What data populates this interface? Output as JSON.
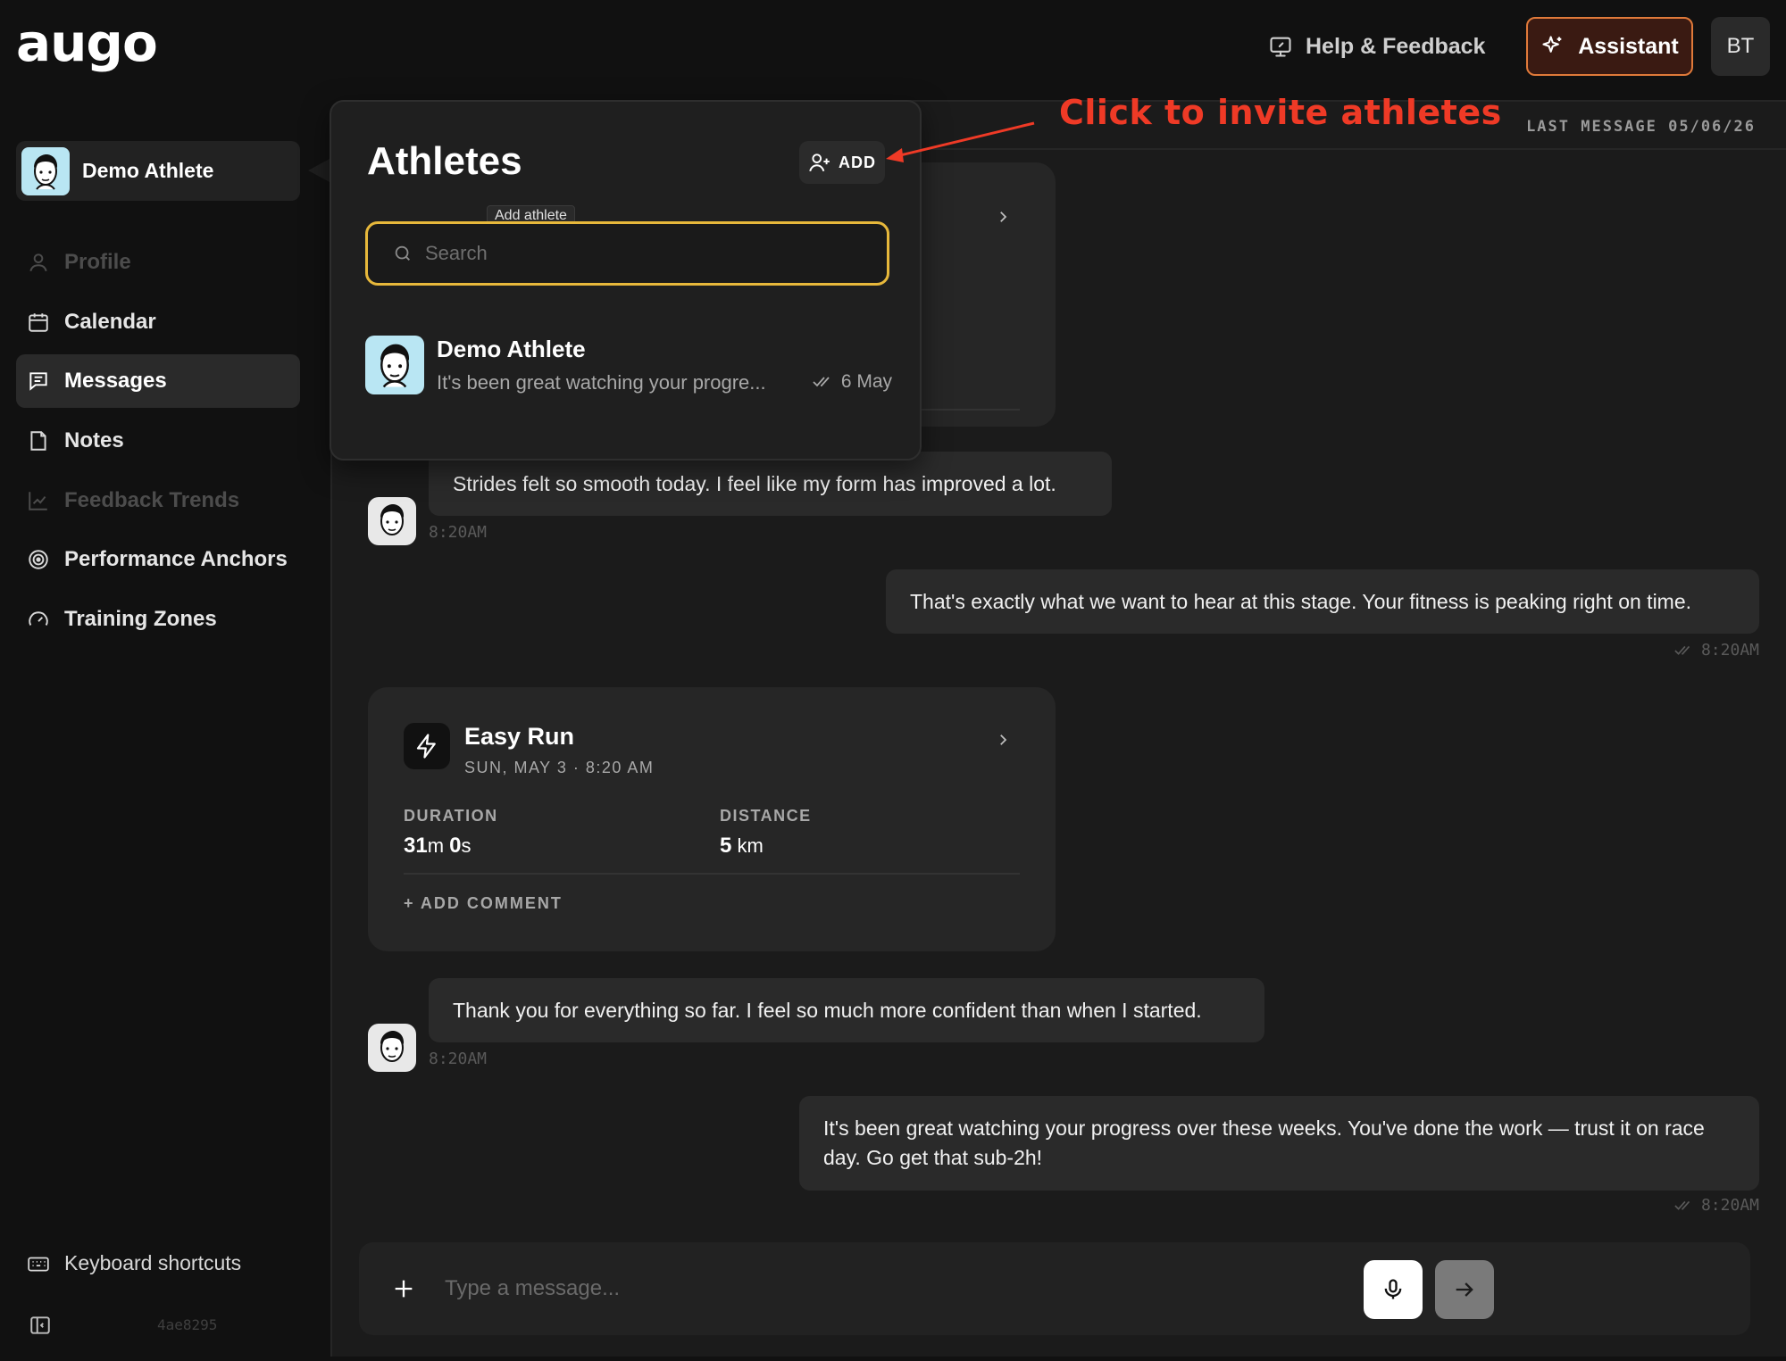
{
  "app": {
    "logo": "augo"
  },
  "topbar": {
    "help_label": "Help & Feedback",
    "assistant_label": "Assistant",
    "user_initials": "BT"
  },
  "sidebar": {
    "current_athlete": "Demo Athlete",
    "items": [
      {
        "label": "Profile",
        "icon": "user-icon",
        "state": "disabled"
      },
      {
        "label": "Calendar",
        "icon": "calendar-icon",
        "state": "normal"
      },
      {
        "label": "Messages",
        "icon": "message-icon",
        "state": "active"
      },
      {
        "label": "Notes",
        "icon": "note-icon",
        "state": "normal"
      },
      {
        "label": "Feedback Trends",
        "icon": "trend-chart-icon",
        "state": "disabled"
      },
      {
        "label": "Performance Anchors",
        "icon": "target-icon",
        "state": "normal"
      },
      {
        "label": "Training Zones",
        "icon": "gauge-icon",
        "state": "normal"
      }
    ],
    "keyboard_shortcuts": "Keyboard shortcuts",
    "version": "4ae8295"
  },
  "chat": {
    "last_message": "LAST MESSAGE 05/06/26",
    "messages": [
      {
        "from": "athlete",
        "text": "Strides felt so smooth today. I feel like my form has improved a lot.",
        "time": "8:20AM"
      },
      {
        "from": "coach",
        "text": "That's exactly what we want to hear at this stage. Your fitness is peaking right on time.",
        "time": "8:20AM"
      },
      {
        "from": "athlete",
        "text": "Thank you for everything so far. I feel so much more confident than when I started.",
        "time": "8:20AM"
      },
      {
        "from": "coach",
        "text": "It's been great watching your progress over these weeks. You've done the work — trust it on race day. Go get that sub-2h!",
        "time": "8:20AM"
      }
    ],
    "activity": {
      "title": "Easy Run",
      "date": "SUN, MAY 3 · 8:20 AM",
      "duration_label": "DURATION",
      "duration_min": "31",
      "duration_min_unit": "m",
      "duration_sec": "0",
      "duration_sec_unit": "s",
      "distance_label": "DISTANCE",
      "distance_value": "5",
      "distance_unit": "km",
      "add_comment": "+  ADD COMMENT"
    },
    "composer": {
      "placeholder": "Type a message..."
    }
  },
  "athletes_popover": {
    "title": "Athletes",
    "add_label": "ADD",
    "tooltip": "Add athlete",
    "search_placeholder": "Search",
    "list": [
      {
        "name": "Demo Athlete",
        "preview": "It's been great watching your progre...",
        "date": "6 May"
      }
    ]
  },
  "annotation": {
    "text": "Click to invite athletes",
    "color": "#ef3a26"
  },
  "colors": {
    "accent_search_border": "#e7b83b",
    "assistant_border": "#e07a3a",
    "background": "#111111"
  }
}
